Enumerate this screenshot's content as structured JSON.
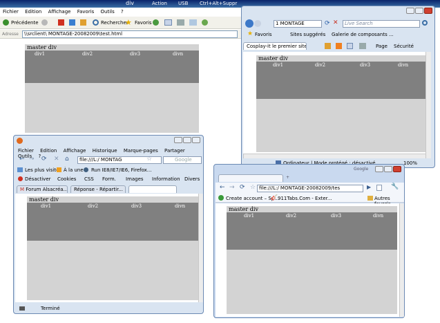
{
  "taskbar": {
    "label": "div",
    "items": [
      "Action",
      "USB",
      "Ctrl+Alt+Suppr"
    ]
  },
  "ie6": {
    "menu": [
      "Fichier",
      "Edition",
      "Affichage",
      "Favoris",
      "Outils",
      "?"
    ],
    "toolbar": {
      "back": "Précédente",
      "search": "Rechercher",
      "favorites": "Favoris"
    },
    "address_label": "Adresse",
    "address_value": "\\\\srclient\\         MONTAGE-20082009\\test.html",
    "page": {
      "master_label": "master div",
      "divs": [
        "div1",
        "div2",
        "div3",
        "divn"
      ]
    }
  },
  "ie8": {
    "address_value": "1                          MONTAGE",
    "search_placeholder": "Live Search",
    "favorites": "Favoris",
    "fav_items": [
      "Sites suggérés",
      "Galerie de composants ..."
    ],
    "tab_title": "Cosplay-it le premier site...",
    "cmd": [
      "Page",
      "Sécurité"
    ],
    "status": "Ordinateur | Mode protégé : désactivé",
    "zoom": "100%",
    "page": {
      "master_label": "master div",
      "divs": [
        "div1",
        "div2",
        "div3",
        "divn"
      ]
    }
  },
  "firefox": {
    "menu": [
      "Fichier",
      "Edition",
      "Affichage",
      "Historique",
      "Marque-pages",
      "Partager",
      "Outils",
      "?"
    ],
    "url": "file:///L:/                   MONTAG",
    "search_placeholder": "Google",
    "bookmarks": [
      "Les plus visités",
      "À la une",
      "Run IE8/IE7/IE6, Firefox..."
    ],
    "devbar": [
      "Désactiver",
      "Cookies",
      "CSS",
      "Form.",
      "Images",
      "Information",
      "Divers"
    ],
    "tabs": [
      "Forum Alsacréa...",
      "Réponse - Répartir..."
    ],
    "status": "Terminé",
    "page": {
      "master_label": "master div",
      "divs": [
        "div1",
        "div2",
        "div3",
        "divn"
      ]
    }
  },
  "chrome": {
    "brand": "Google",
    "url": "file:///L:/                    MONTAGE-20082009/tes",
    "bookmarks": [
      "Create account – Sp...",
      "911Tabs.Com - Exter..."
    ],
    "other_bookmarks": "Autres favoris",
    "page": {
      "master_label": "master div",
      "divs": [
        "div1",
        "div2",
        "div3",
        "divn"
      ]
    }
  }
}
